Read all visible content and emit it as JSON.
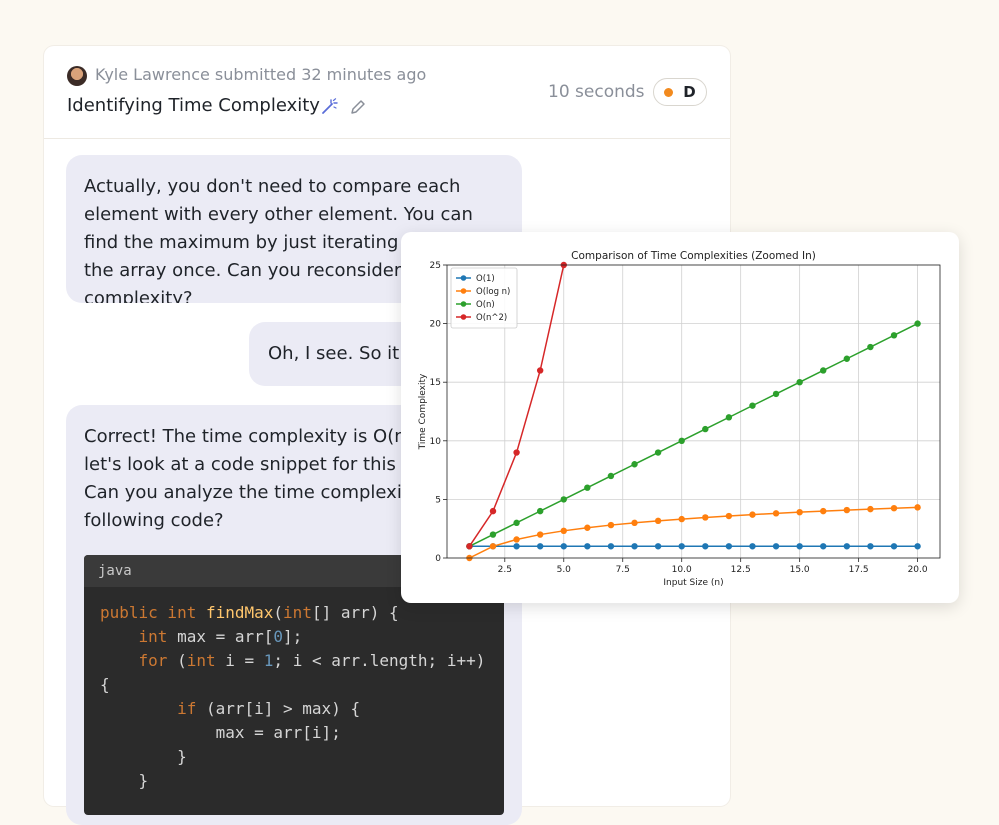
{
  "header": {
    "submitted_text": "Kyle Lawrence submitted 32 minutes ago",
    "title": "Identifying Time Complexity",
    "duration": "10 seconds",
    "grade": "D",
    "grade_color": "#f28a1e"
  },
  "messages": [
    {
      "role": "assistant",
      "text": "Actually, you don't need to compare each element with every other element. You can find the maximum by just iterating through the array once. Can you reconsider the time complexity?"
    },
    {
      "role": "user",
      "text": "Oh, I see. So it would be O(n)?"
    },
    {
      "role": "assistant",
      "text": "Correct! The time complexity is O(n). Now let's look at a code snippet for this problem. Can you analyze the time complexity of the following code?"
    }
  ],
  "code_block": {
    "language": "java",
    "lines": [
      "public int findMax(int[] arr) {",
      "    int max = arr[0];",
      "    for (int i = 1; i < arr.length; i++)",
      "{",
      "        if (arr[i] > max) {",
      "            max = arr[i];",
      "        }",
      "    }"
    ]
  },
  "chart_data": {
    "type": "line",
    "title": "Comparison of Time Complexities (Zoomed In)",
    "xlabel": "Input Size (n)",
    "ylabel": "Time Complexity",
    "xlim": [
      0.05,
      20.95
    ],
    "ylim": [
      0,
      25
    ],
    "xticks": [
      "2.5",
      "5.0",
      "7.5",
      "10.0",
      "12.5",
      "15.0",
      "17.5",
      "20.0"
    ],
    "yticks": [
      "0",
      "5",
      "10",
      "15",
      "20",
      "25"
    ],
    "grid": true,
    "legend_position": "top-left",
    "x": [
      1,
      2,
      3,
      4,
      5,
      6,
      7,
      8,
      9,
      10,
      11,
      12,
      13,
      14,
      15,
      16,
      17,
      18,
      19,
      20
    ],
    "series": [
      {
        "name": "O(1)",
        "color": "#1f77b4",
        "values": [
          1,
          1,
          1,
          1,
          1,
          1,
          1,
          1,
          1,
          1,
          1,
          1,
          1,
          1,
          1,
          1,
          1,
          1,
          1,
          1
        ]
      },
      {
        "name": "O(log n)",
        "color": "#ff7f0e",
        "values": [
          0,
          1,
          1.58,
          2,
          2.32,
          2.58,
          2.81,
          3,
          3.17,
          3.32,
          3.46,
          3.58,
          3.7,
          3.81,
          3.91,
          4,
          4.09,
          4.17,
          4.25,
          4.32
        ]
      },
      {
        "name": "O(n)",
        "color": "#2ca02c",
        "values": [
          1,
          2,
          3,
          4,
          5,
          6,
          7,
          8,
          9,
          10,
          11,
          12,
          13,
          14,
          15,
          16,
          17,
          18,
          19,
          20
        ]
      },
      {
        "name": "O(n^2)",
        "color": "#d62728",
        "values": [
          1,
          4,
          9,
          16,
          25
        ]
      }
    ]
  }
}
